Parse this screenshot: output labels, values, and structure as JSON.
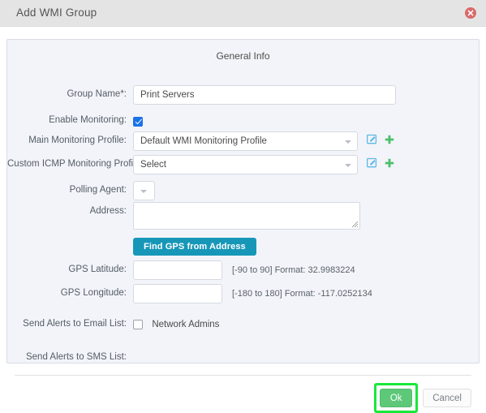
{
  "window": {
    "title": "Add WMI Group",
    "close_icon": "close-circle-icon"
  },
  "panel": {
    "section_title": "General Info"
  },
  "form": {
    "group_name": {
      "label": "Group Name*:",
      "value": "Print Servers",
      "placeholder": ""
    },
    "enable_monitoring": {
      "label": "Enable Monitoring:",
      "checked": true
    },
    "main_monitoring_profile": {
      "label": "Main Monitoring Profile:",
      "value": "Default WMI Monitoring Profile",
      "edit_icon": "edit-icon",
      "add_icon": "plus-icon"
    },
    "custom_icmp_profile": {
      "label": "Custom ICMP Monitoring Profile:",
      "value": "Select",
      "edit_icon": "edit-icon",
      "add_icon": "plus-icon"
    },
    "polling_agent": {
      "label": "Polling Agent:",
      "value": ""
    },
    "address": {
      "label": "Address:",
      "value": "",
      "placeholder": ""
    },
    "find_gps_button": {
      "label": "Find GPS from Address"
    },
    "gps_latitude": {
      "label": "GPS Latitude:",
      "value": "",
      "hint": "[-90 to 90]   Format: 32.9983224"
    },
    "gps_longitude": {
      "label": "GPS Longitude:",
      "value": "",
      "hint": "[-180 to 180]   Format: -117.0252134"
    },
    "email_list": {
      "label": "Send Alerts to Email List:",
      "option_label": "Network Admins",
      "checked": false
    },
    "sms_list": {
      "label": "Send Alerts to SMS List:"
    }
  },
  "footer": {
    "ok_label": "Ok",
    "cancel_label": "Cancel"
  },
  "colors": {
    "titlebar": "#e4e4e4",
    "panel_bg": "#f2f4f9",
    "accent_teal": "#1797b8",
    "accent_green": "#5cc878",
    "highlight_green": "#18e83a",
    "checkbox_blue": "#1a73e8",
    "edit_icon_blue": "#5bb8e8",
    "plus_icon_green": "#4cbf6a",
    "close_red": "#d96a6a"
  }
}
